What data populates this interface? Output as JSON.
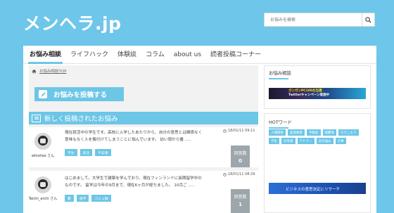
{
  "header": {
    "logo": "メンヘラ.jp",
    "search_placeholder": "お悩みを検索"
  },
  "nav": {
    "items": [
      {
        "label": "お悩み相談",
        "active": true
      },
      {
        "label": "ライフハック",
        "active": false
      },
      {
        "label": "体験談",
        "active": false
      },
      {
        "label": "コラム",
        "active": false
      },
      {
        "label": "about us",
        "active": false
      },
      {
        "label": "読者投稿コーナー",
        "active": false
      }
    ]
  },
  "breadcrumb": "お悩み相談TOP",
  "post_button": "お悩みを投稿する",
  "section_title": "新しく投稿されたお悩み",
  "posts": [
    {
      "user": "whrolise さん",
      "excerpt": "現在就活中の学生です。高校に入学したあたりから、自分の意思とは関係なく意味もなく人を傷付けてしまうことに悩んでいます。 幼い頃から優 .....",
      "tags": [
        "学生",
        "就活",
        "不安感"
      ],
      "date": "18/01/11 09:11",
      "count_label": "回答数",
      "count": "0"
    },
    {
      "user": "Taichi_archi さん",
      "excerpt": "はじめまして。大学生で建築を学んでおり、現在フィンランドに長期留学中のものです。 留学は今年の9月まで、現在6ヶ月が経ちました。 10月ご .....",
      "tags": [
        "鬱",
        "留学",
        "コミュ障"
      ],
      "date": "18/01/11 08:29",
      "count_label": "回答数",
      "count": "1"
    }
  ],
  "sidebar": {
    "widget1_title": "お悩み相談",
    "banner1_text_line1": "ガンガンPC100台当選",
    "banner1_text_line2": "Twitterキャンペーン実施中",
    "widget2_title": "HOTワード",
    "hot_words": [
      "人間関係",
      "発達障害",
      "不眠症",
      "躁鬱病",
      "引きこもり",
      "学生",
      "劣等感",
      "アドラー",
      "恋の悩み",
      "仕事"
    ],
    "banner2_text": "ビジネスの意思決定にリサーチ"
  },
  "colors": {
    "accent": "#6cc6e6",
    "page_bg": "#6ec6ea",
    "count_bg": "#9da6ab"
  }
}
